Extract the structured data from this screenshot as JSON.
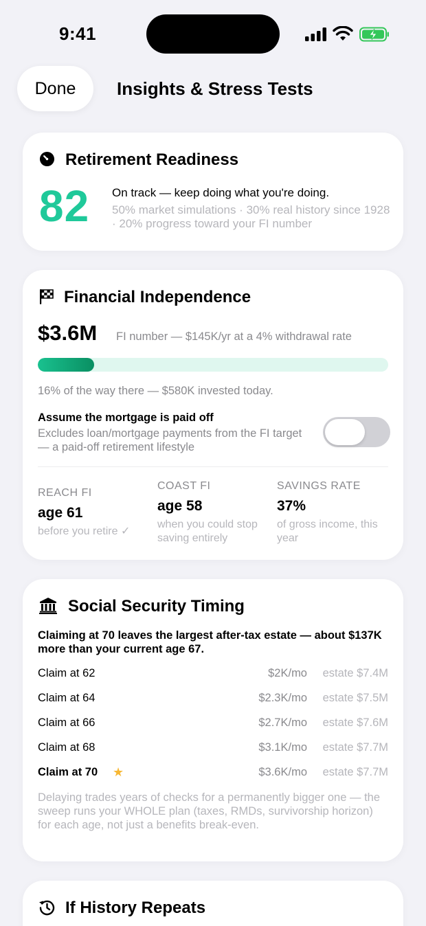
{
  "status_bar": {
    "time": "9:41",
    "battery_color": "#34c759"
  },
  "nav": {
    "done_label": "Done",
    "title": "Insights & Stress Tests"
  },
  "readiness": {
    "title": "Retirement Readiness",
    "icon": "gauge-icon",
    "score": "82",
    "score_color": "#1fc99a",
    "headline": "On track — keep doing what you're doing.",
    "detail": "50% market simulations · 30% real history since 1928 · 20% progress toward your FI number"
  },
  "fi": {
    "title": "Financial Independence",
    "icon": "checkered-flag-icon",
    "amount": "$3.6M",
    "description": "FI number — $145K/yr at a 4% withdrawal rate",
    "progress_fraction": 0.16,
    "progress_text": "16% of the way there — $580K invested today.",
    "mortgage_title": "Assume the mortgage is paid off",
    "mortgage_desc": "Excludes loan/mortgage payments from the FI target — a paid-off retirement lifestyle",
    "mortgage_toggle_on": false,
    "stats": [
      {
        "label": "REACH FI",
        "value": "age 61",
        "sub": "before you retire ✓"
      },
      {
        "label": "COAST FI",
        "value": "age 58",
        "sub": "when you could stop saving entirely"
      },
      {
        "label": "SAVINGS RATE",
        "value": "37%",
        "sub": "of gross income, this year"
      }
    ]
  },
  "social_security": {
    "title": "Social Security Timing",
    "icon": "bank-building-icon",
    "summary": "Claiming at 70 leaves the largest after-tax estate — about $137K more than your current age 67.",
    "rows": [
      {
        "claim": "Claim at 62",
        "monthly": "$2K/mo",
        "estate": "estate $7.4M"
      },
      {
        "claim": "Claim at 64",
        "monthly": "$2.3K/mo",
        "estate": "estate $7.5M"
      },
      {
        "claim": "Claim at 66",
        "monthly": "$2.7K/mo",
        "estate": "estate $7.6M"
      },
      {
        "claim": "Claim at 68",
        "monthly": "$3.1K/mo",
        "estate": "estate $7.7M"
      },
      {
        "claim": "Claim at 70",
        "monthly": "$3.6K/mo",
        "estate": "estate $7.7M",
        "best": true,
        "star": "★"
      }
    ],
    "note": "Delaying trades years of checks for a permanently bigger one — the sweep runs your WHOLE plan (taxes, RMDs, survivorship horizon) for each age, not just a benefits break-even."
  },
  "history": {
    "title": "If History Repeats",
    "icon": "history-clock-icon"
  }
}
